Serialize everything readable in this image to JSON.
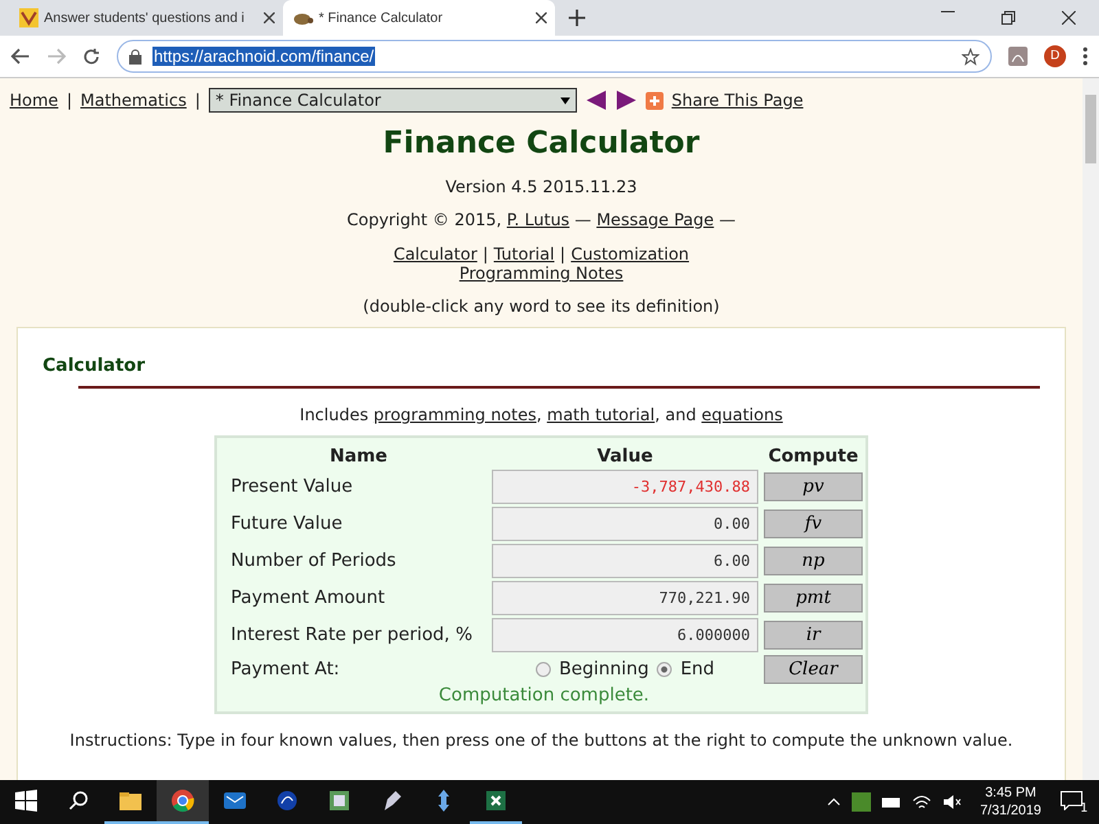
{
  "browser": {
    "tabs": [
      {
        "title": "Answer students' questions and i",
        "selected": false,
        "kind": "site"
      },
      {
        "title": "* Finance Calculator",
        "selected": true,
        "kind": "finance"
      }
    ],
    "address": "https://arachnoid.com/finance/",
    "profile": "D"
  },
  "nav": {
    "links": [
      "Home",
      "Mathematics"
    ],
    "separator": "|",
    "select": "* Finance Calculator",
    "share": "Share This Page"
  },
  "title": "Finance Calculator",
  "version": "Version 4.5 2015.11.23",
  "copyright": [
    {
      "kind": "text",
      "text": "Copyright © 2015, "
    },
    {
      "kind": "link",
      "text": "P. Lutus"
    },
    {
      "kind": "text",
      "text": " — "
    },
    {
      "kind": "link",
      "text": "Message Page"
    },
    {
      "kind": "text",
      "text": " —"
    }
  ],
  "doc_links": [
    [
      "Calculator",
      "Tutorial",
      "Customization"
    ],
    [
      "Programming Notes"
    ]
  ],
  "doc_links_separator": "|",
  "hint": "(double-click any word to see its definition)",
  "section": {
    "heading": "Calculator",
    "includes": [
      {
        "kind": "text",
        "text": "Includes "
      },
      {
        "kind": "link",
        "text": "programming notes"
      },
      {
        "kind": "text",
        "text": ", "
      },
      {
        "kind": "link",
        "text": "math tutorial"
      },
      {
        "kind": "text",
        "text": ", and "
      },
      {
        "kind": "link",
        "text": "equations"
      }
    ],
    "calculator": {
      "columns": [
        "Name",
        "Value",
        "Compute"
      ],
      "rows": [
        {
          "name": "Present Value",
          "value": "-3,787,430.88",
          "negative": true,
          "button": "pv"
        },
        {
          "name": "Future Value",
          "value": "0.00",
          "negative": false,
          "button": "fv"
        },
        {
          "name": "Number of Periods",
          "value": "6.00",
          "negative": false,
          "button": "np"
        },
        {
          "name": "Payment Amount",
          "value": "770,221.90",
          "negative": false,
          "button": "pmt"
        },
        {
          "name": "Interest Rate per period, %",
          "value": "6.000000",
          "negative": false,
          "button": "ir"
        }
      ],
      "payment_at": {
        "label": "Payment At:",
        "options": [
          {
            "label": "Beginning",
            "selected": false
          },
          {
            "label": "End",
            "selected": true
          }
        ]
      },
      "clear": "Clear",
      "status": "Computation complete."
    },
    "instructions": "Instructions: Type in four known values, then press one of the buttons at the right to compute the unknown value."
  },
  "taskbar": {
    "apps": [
      {
        "kind": "folder",
        "running": true,
        "selected": false
      },
      {
        "kind": "chrome",
        "running": true,
        "selected": true
      },
      {
        "kind": "mail",
        "running": false,
        "selected": false
      },
      {
        "kind": "edge",
        "running": false,
        "selected": false
      },
      {
        "kind": "tool",
        "running": false,
        "selected": false
      },
      {
        "kind": "pen",
        "running": false,
        "selected": false
      },
      {
        "kind": "arrows",
        "running": false,
        "selected": false
      },
      {
        "kind": "excel",
        "running": true,
        "selected": false
      }
    ],
    "time": "3:45 PM",
    "date": "7/31/2019",
    "notifications": "1"
  }
}
